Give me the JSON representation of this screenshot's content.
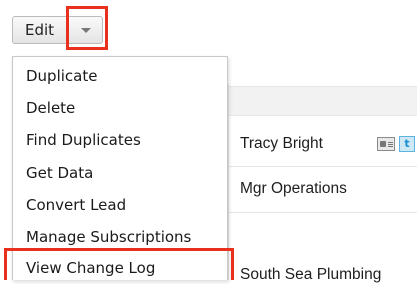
{
  "toolbar": {
    "edit_label": "Edit",
    "caret_icon": "chevron-down-icon"
  },
  "menu": {
    "items": [
      {
        "label": "Duplicate"
      },
      {
        "label": "Delete"
      },
      {
        "label": "Find Duplicates"
      },
      {
        "label": "Get Data"
      },
      {
        "label": "Convert Lead"
      },
      {
        "label": "Manage Subscriptions"
      },
      {
        "label": "View Change Log"
      }
    ]
  },
  "record": {
    "name": "Tracy Bright",
    "title": "Mgr Operations",
    "account": "South Sea Plumbing",
    "twitter_glyph": "t"
  },
  "colors": {
    "highlight": "#e8301d"
  }
}
